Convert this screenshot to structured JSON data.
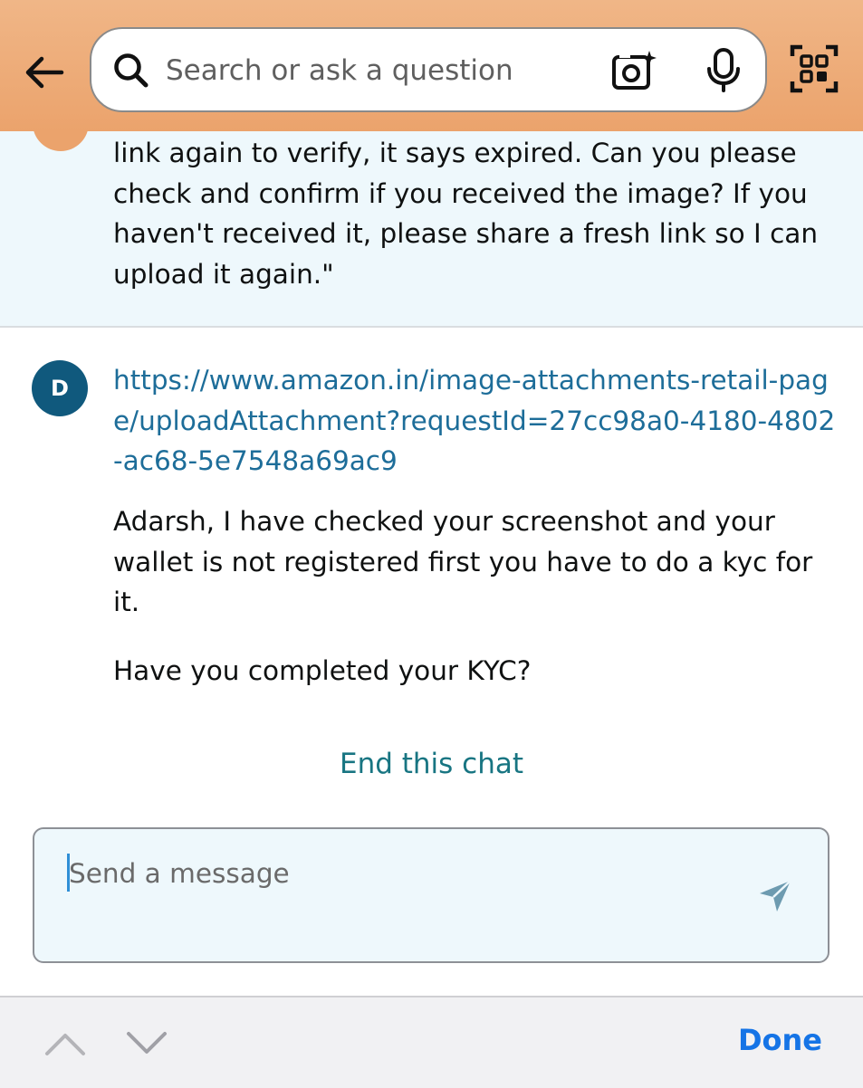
{
  "header": {
    "search_placeholder": "Search or ask a question",
    "icons": [
      "back-arrow-icon",
      "search-icon",
      "camera-icon",
      "microphone-icon",
      "qr-scan-icon"
    ]
  },
  "chat": {
    "user_message_partial": "link again to verify, it says expired. Can you please check and confirm if you received the image? If you haven't received it, please share a fresh link so I can upload it again.\"",
    "agent": {
      "avatar_initial": "D",
      "link": "https://www.amazon.in/image-attachments-retail-page/uploadAttachment?requestId=27cc98a0-4180-4802-ac68-5e7548a69ac9",
      "message_1": "Adarsh, I have checked your screenshot and your wallet is not registered first you have to do a kyc for it.",
      "message_2": "Have you completed your KYC?"
    },
    "end_chat_label": "End this chat",
    "composer_placeholder": "Send a message"
  },
  "keyboard_bar": {
    "done_label": "Done"
  },
  "colors": {
    "header_bg": "#eba36c",
    "link": "#1d6d99",
    "end_chat": "#187582",
    "agent_avatar": "#10597d",
    "done": "#1574e6"
  }
}
